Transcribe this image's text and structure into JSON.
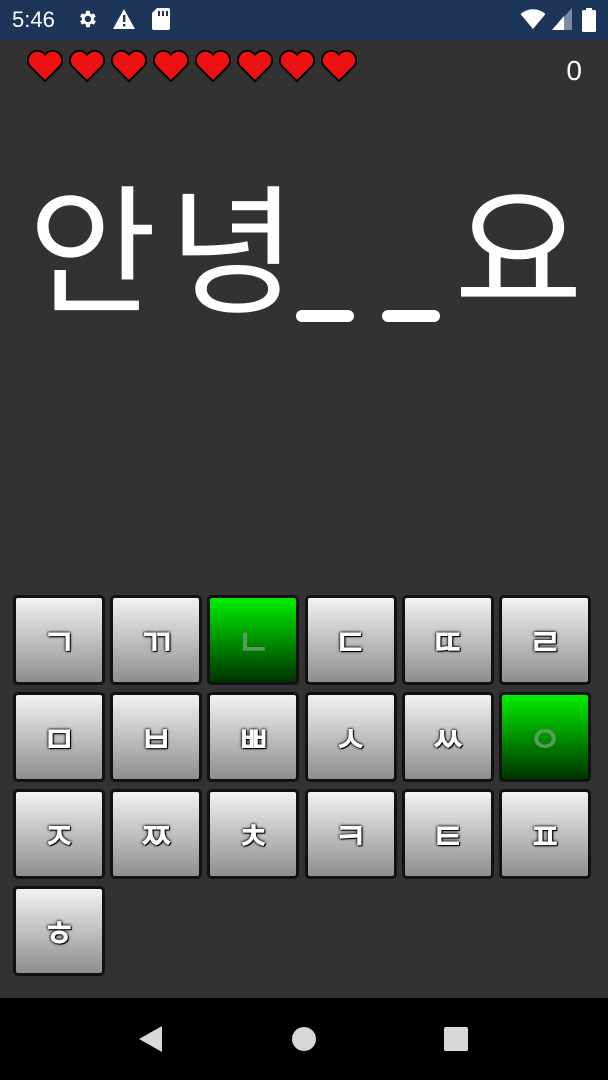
{
  "status_bar": {
    "time": "5:46",
    "icons_left": [
      "settings-icon",
      "warning-icon",
      "sd-card-icon"
    ],
    "icons_right": [
      "wifi-icon",
      "signal-icon",
      "battery-icon"
    ]
  },
  "game": {
    "lives": 8,
    "score": "0",
    "word": {
      "syllables": [
        "안",
        "녕",
        "요"
      ],
      "blank_count": 2
    }
  },
  "keyboard": {
    "keys": [
      {
        "label": "ㄱ",
        "highlighted": false
      },
      {
        "label": "ㄲ",
        "highlighted": false
      },
      {
        "label": "ㄴ",
        "highlighted": true
      },
      {
        "label": "ㄷ",
        "highlighted": false
      },
      {
        "label": "ㄸ",
        "highlighted": false
      },
      {
        "label": "ㄹ",
        "highlighted": false
      },
      {
        "label": "ㅁ",
        "highlighted": false
      },
      {
        "label": "ㅂ",
        "highlighted": false
      },
      {
        "label": "ㅃ",
        "highlighted": false
      },
      {
        "label": "ㅅ",
        "highlighted": false
      },
      {
        "label": "ㅆ",
        "highlighted": false
      },
      {
        "label": "ㅇ",
        "highlighted": true
      },
      {
        "label": "ㅈ",
        "highlighted": false
      },
      {
        "label": "ㅉ",
        "highlighted": false
      },
      {
        "label": "ㅊ",
        "highlighted": false
      },
      {
        "label": "ㅋ",
        "highlighted": false
      },
      {
        "label": "ㅌ",
        "highlighted": false
      },
      {
        "label": "ㅍ",
        "highlighted": false
      },
      {
        "label": "ㅎ",
        "highlighted": false
      }
    ]
  },
  "nav_bar": {
    "buttons": [
      "back-icon",
      "home-icon",
      "recents-icon"
    ]
  },
  "colors": {
    "background": "#323232",
    "status_bar": "#1c3558",
    "heart": "#ee1111",
    "key_highlight": "#00ee00"
  }
}
